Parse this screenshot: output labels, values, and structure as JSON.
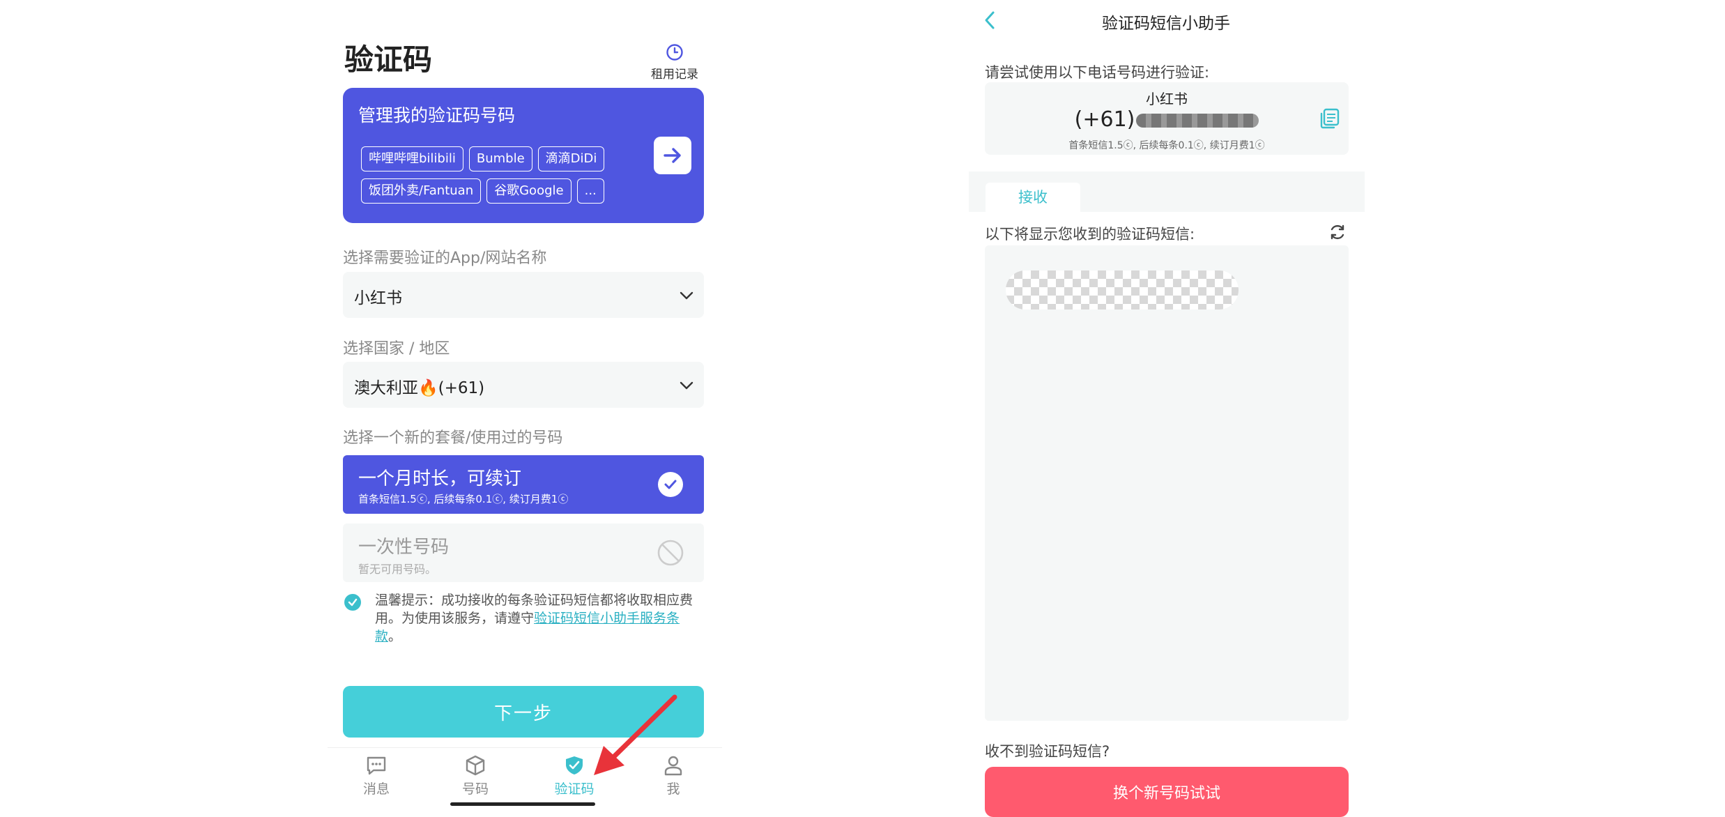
{
  "left": {
    "page_title": "验证码",
    "rent_record_label": "租用记录",
    "manage_card": {
      "title": "管理我的验证码号码",
      "chips": [
        "哔哩哔哩bilibili",
        "Bumble",
        "滴滴DiDi",
        "饭团外卖/Fantuan",
        "谷歌Google",
        "..."
      ]
    },
    "app_select": {
      "label": "选择需要验证的App/网站名称",
      "value": "小红书"
    },
    "country_select": {
      "label": "选择国家 / 地区",
      "value": "澳大利亚🔥(+61)"
    },
    "plan_section_label": "选择一个新的套餐/使用过的号码",
    "plans": [
      {
        "name": "一个月时长，可续订",
        "desc": "首条短信1.5ⓒ, 后续每条0.1ⓒ, 续订月费1ⓒ",
        "selected": true
      },
      {
        "name": "一次性号码",
        "desc": "暂无可用号码。",
        "selected": false
      }
    ],
    "agreement": {
      "prefix": "温馨提示：成功接收的每条验证码短信都将收取相应费用。为使用该服务，请遵守",
      "link": "验证码短信小助手服务条款",
      "suffix": "。"
    },
    "next_button": "下一步",
    "tabbar": [
      {
        "label": "消息",
        "icon": "message-icon",
        "active": false
      },
      {
        "label": "号码",
        "icon": "box-icon",
        "active": false
      },
      {
        "label": "验证码",
        "icon": "shield-check-icon",
        "active": true
      },
      {
        "label": "我",
        "icon": "person-icon",
        "active": false
      }
    ]
  },
  "right": {
    "nav_title": "验证码短信小助手",
    "try_hint": "请尝试使用以下电话号码进行验证:",
    "number_card": {
      "app_name": "小红书",
      "phone_prefix": "(+61)",
      "desc": "首条短信1.5ⓒ, 后续每条0.1ⓒ, 续订月费1ⓒ"
    },
    "tab_receive": "接收",
    "receive_hint": "以下将显示您收到的验证码短信:",
    "no_sms_hint": "收不到验证码短信?",
    "new_number_button": "换个新号码试试"
  },
  "colors": {
    "primary_purple": "#4f56e0",
    "accent_teal": "#45cfd9",
    "danger_pink": "#ff5a6e",
    "annotation_red": "#e8333a"
  }
}
